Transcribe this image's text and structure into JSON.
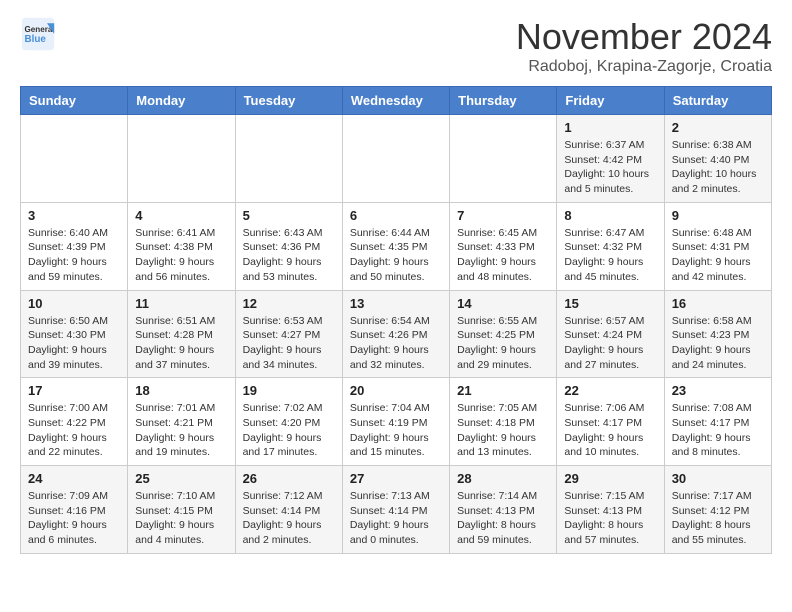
{
  "header": {
    "logo_line1": "General",
    "logo_line2": "Blue",
    "month": "November 2024",
    "location": "Radoboj, Krapina-Zagorje, Croatia"
  },
  "days_of_week": [
    "Sunday",
    "Monday",
    "Tuesday",
    "Wednesday",
    "Thursday",
    "Friday",
    "Saturday"
  ],
  "weeks": [
    [
      {
        "day": "",
        "detail": ""
      },
      {
        "day": "",
        "detail": ""
      },
      {
        "day": "",
        "detail": ""
      },
      {
        "day": "",
        "detail": ""
      },
      {
        "day": "",
        "detail": ""
      },
      {
        "day": "1",
        "detail": "Sunrise: 6:37 AM\nSunset: 4:42 PM\nDaylight: 10 hours and 5 minutes."
      },
      {
        "day": "2",
        "detail": "Sunrise: 6:38 AM\nSunset: 4:40 PM\nDaylight: 10 hours and 2 minutes."
      }
    ],
    [
      {
        "day": "3",
        "detail": "Sunrise: 6:40 AM\nSunset: 4:39 PM\nDaylight: 9 hours and 59 minutes."
      },
      {
        "day": "4",
        "detail": "Sunrise: 6:41 AM\nSunset: 4:38 PM\nDaylight: 9 hours and 56 minutes."
      },
      {
        "day": "5",
        "detail": "Sunrise: 6:43 AM\nSunset: 4:36 PM\nDaylight: 9 hours and 53 minutes."
      },
      {
        "day": "6",
        "detail": "Sunrise: 6:44 AM\nSunset: 4:35 PM\nDaylight: 9 hours and 50 minutes."
      },
      {
        "day": "7",
        "detail": "Sunrise: 6:45 AM\nSunset: 4:33 PM\nDaylight: 9 hours and 48 minutes."
      },
      {
        "day": "8",
        "detail": "Sunrise: 6:47 AM\nSunset: 4:32 PM\nDaylight: 9 hours and 45 minutes."
      },
      {
        "day": "9",
        "detail": "Sunrise: 6:48 AM\nSunset: 4:31 PM\nDaylight: 9 hours and 42 minutes."
      }
    ],
    [
      {
        "day": "10",
        "detail": "Sunrise: 6:50 AM\nSunset: 4:30 PM\nDaylight: 9 hours and 39 minutes."
      },
      {
        "day": "11",
        "detail": "Sunrise: 6:51 AM\nSunset: 4:28 PM\nDaylight: 9 hours and 37 minutes."
      },
      {
        "day": "12",
        "detail": "Sunrise: 6:53 AM\nSunset: 4:27 PM\nDaylight: 9 hours and 34 minutes."
      },
      {
        "day": "13",
        "detail": "Sunrise: 6:54 AM\nSunset: 4:26 PM\nDaylight: 9 hours and 32 minutes."
      },
      {
        "day": "14",
        "detail": "Sunrise: 6:55 AM\nSunset: 4:25 PM\nDaylight: 9 hours and 29 minutes."
      },
      {
        "day": "15",
        "detail": "Sunrise: 6:57 AM\nSunset: 4:24 PM\nDaylight: 9 hours and 27 minutes."
      },
      {
        "day": "16",
        "detail": "Sunrise: 6:58 AM\nSunset: 4:23 PM\nDaylight: 9 hours and 24 minutes."
      }
    ],
    [
      {
        "day": "17",
        "detail": "Sunrise: 7:00 AM\nSunset: 4:22 PM\nDaylight: 9 hours and 22 minutes."
      },
      {
        "day": "18",
        "detail": "Sunrise: 7:01 AM\nSunset: 4:21 PM\nDaylight: 9 hours and 19 minutes."
      },
      {
        "day": "19",
        "detail": "Sunrise: 7:02 AM\nSunset: 4:20 PM\nDaylight: 9 hours and 17 minutes."
      },
      {
        "day": "20",
        "detail": "Sunrise: 7:04 AM\nSunset: 4:19 PM\nDaylight: 9 hours and 15 minutes."
      },
      {
        "day": "21",
        "detail": "Sunrise: 7:05 AM\nSunset: 4:18 PM\nDaylight: 9 hours and 13 minutes."
      },
      {
        "day": "22",
        "detail": "Sunrise: 7:06 AM\nSunset: 4:17 PM\nDaylight: 9 hours and 10 minutes."
      },
      {
        "day": "23",
        "detail": "Sunrise: 7:08 AM\nSunset: 4:17 PM\nDaylight: 9 hours and 8 minutes."
      }
    ],
    [
      {
        "day": "24",
        "detail": "Sunrise: 7:09 AM\nSunset: 4:16 PM\nDaylight: 9 hours and 6 minutes."
      },
      {
        "day": "25",
        "detail": "Sunrise: 7:10 AM\nSunset: 4:15 PM\nDaylight: 9 hours and 4 minutes."
      },
      {
        "day": "26",
        "detail": "Sunrise: 7:12 AM\nSunset: 4:14 PM\nDaylight: 9 hours and 2 minutes."
      },
      {
        "day": "27",
        "detail": "Sunrise: 7:13 AM\nSunset: 4:14 PM\nDaylight: 9 hours and 0 minutes."
      },
      {
        "day": "28",
        "detail": "Sunrise: 7:14 AM\nSunset: 4:13 PM\nDaylight: 8 hours and 59 minutes."
      },
      {
        "day": "29",
        "detail": "Sunrise: 7:15 AM\nSunset: 4:13 PM\nDaylight: 8 hours and 57 minutes."
      },
      {
        "day": "30",
        "detail": "Sunrise: 7:17 AM\nSunset: 4:12 PM\nDaylight: 8 hours and 55 minutes."
      }
    ]
  ]
}
